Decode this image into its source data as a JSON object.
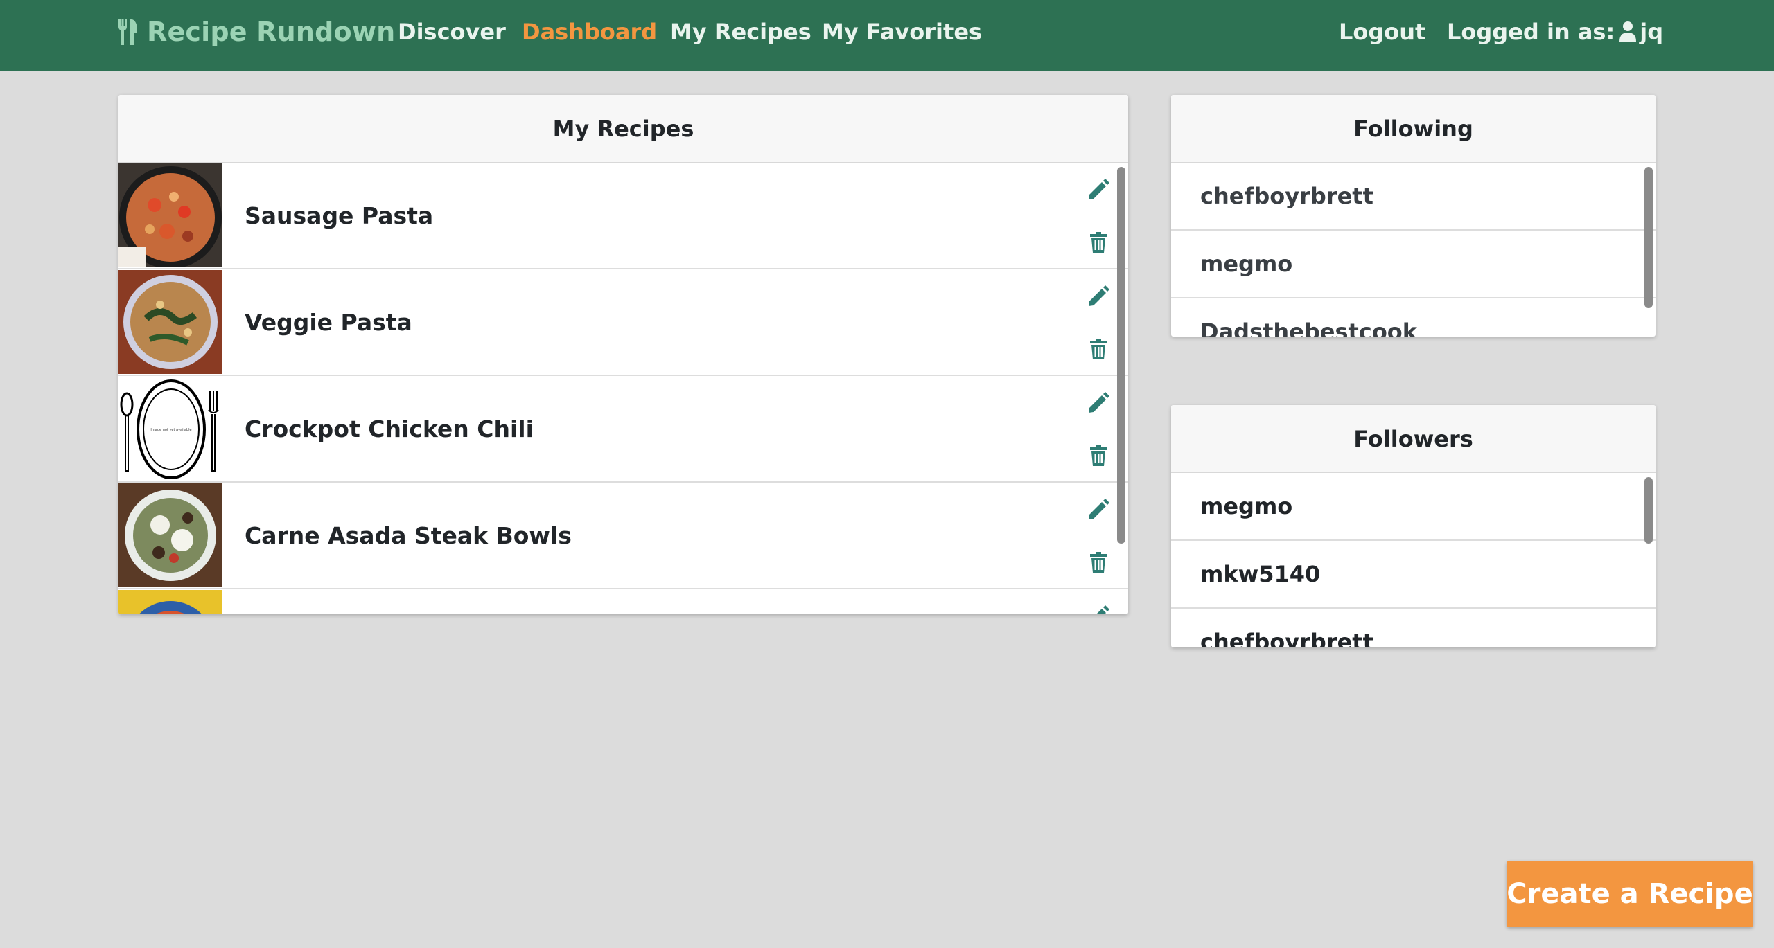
{
  "colors": {
    "navbar": "#2d7153",
    "brand": "#9bd3b4",
    "active": "#f39640",
    "accent_icon": "#2e7d74",
    "button": "#f39640"
  },
  "nav": {
    "brand": "Recipe Rundown",
    "brand_icon": "utensils-icon",
    "links": [
      "Discover",
      "Dashboard",
      "My Recipes",
      "My Favorites"
    ],
    "active_link": "Dashboard",
    "logout": "Logout",
    "logged_in_prefix": "Logged in as:",
    "username": "jq"
  },
  "recipes": {
    "title": "My Recipes",
    "items": [
      {
        "name": "Sausage Pasta",
        "thumb": "pasta-pan-photo"
      },
      {
        "name": "Veggie Pasta",
        "thumb": "veggie-pasta-photo"
      },
      {
        "name": "Crockpot Chicken Chili",
        "thumb": "placeholder-plate",
        "thumb_text": "Image not yet available"
      },
      {
        "name": "Carne Asada Steak Bowls",
        "thumb": "steak-bowl-photo"
      },
      {
        "name": "",
        "thumb": "yellow-bowl-photo"
      }
    ],
    "edit_icon": "pencil-icon",
    "delete_icon": "trash-icon"
  },
  "following": {
    "title": "Following",
    "users": [
      "chefboyrbrett",
      "megmo",
      "Dadsthebestcook"
    ]
  },
  "followers": {
    "title": "Followers",
    "users": [
      "megmo",
      "mkw5140",
      "chefboyrbrett"
    ]
  },
  "create_button": "Create a Recipe"
}
